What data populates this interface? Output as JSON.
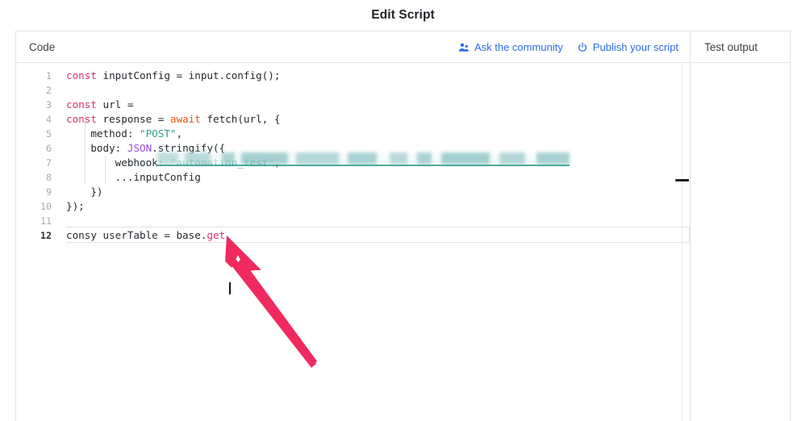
{
  "modal": {
    "title": "Edit Script"
  },
  "code_pane": {
    "title": "Code",
    "actions": [
      {
        "label": "Ask the community",
        "icon": "people-icon"
      },
      {
        "label": "Publish your script",
        "icon": "power-publish-icon"
      }
    ],
    "editor": {
      "active_line": 12,
      "caret_after": "base.get",
      "redacted_line": 3,
      "redacted_note": "blurred url string",
      "lines": [
        {
          "n": "1",
          "tokens": [
            {
              "t": "const",
              "c": "kw"
            },
            {
              "t": " inputConfig = input.config();",
              "c": ""
            }
          ]
        },
        {
          "n": "2",
          "tokens": []
        },
        {
          "n": "3",
          "tokens": [
            {
              "t": "const",
              "c": "kw"
            },
            {
              "t": " url = ",
              "c": ""
            }
          ]
        },
        {
          "n": "4",
          "tokens": [
            {
              "t": "const",
              "c": "kw"
            },
            {
              "t": " response = ",
              "c": ""
            },
            {
              "t": "await",
              "c": "kw2"
            },
            {
              "t": " fetch(url, {",
              "c": ""
            }
          ]
        },
        {
          "n": "5",
          "tokens": [
            {
              "t": "    method: ",
              "c": ""
            },
            {
              "t": "\"POST\"",
              "c": "str"
            },
            {
              "t": ",",
              "c": ""
            }
          ]
        },
        {
          "n": "6",
          "tokens": [
            {
              "t": "    body: ",
              "c": ""
            },
            {
              "t": "JSON",
              "c": "cls"
            },
            {
              "t": ".stringify({",
              "c": ""
            }
          ]
        },
        {
          "n": "7",
          "tokens": [
            {
              "t": "        webhook: ",
              "c": ""
            },
            {
              "t": "\"automation_test\"",
              "c": "str"
            },
            {
              "t": ",",
              "c": ""
            }
          ]
        },
        {
          "n": "8",
          "tokens": [
            {
              "t": "        ...inputConfig",
              "c": ""
            }
          ]
        },
        {
          "n": "9",
          "tokens": [
            {
              "t": "    })",
              "c": ""
            }
          ]
        },
        {
          "n": "10",
          "tokens": [
            {
              "t": "});",
              "c": ""
            }
          ]
        },
        {
          "n": "11",
          "tokens": []
        },
        {
          "n": "12",
          "tokens": [
            {
              "t": "consy userTable = base.",
              "c": ""
            },
            {
              "t": "get",
              "c": "kw"
            }
          ]
        }
      ]
    }
  },
  "output_pane": {
    "title": "Test output",
    "content": ""
  },
  "splitter": {
    "handle": "resize-handle"
  },
  "annotation": {
    "type": "arrow",
    "color": "#f02a5e",
    "points_to": "text cursor at end of line 12"
  },
  "colors": {
    "link": "#2d6ce0",
    "keyword": "#d6336c",
    "keyword_alt": "#e8590c",
    "string": "#2f9e8f",
    "class": "#9a4dd6",
    "text": "#24292e",
    "border": "#e3e4e6",
    "arrow": "#f02a5e"
  }
}
